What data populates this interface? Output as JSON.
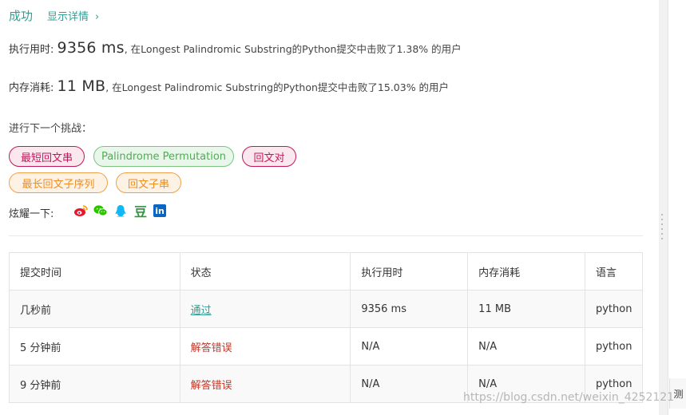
{
  "status": {
    "result": "成功",
    "details_link": "显示详情",
    "chevron": "›"
  },
  "runtime": {
    "label": "执行用时:",
    "value": "9356 ms",
    "desc": ", 在Longest Palindromic Substring的Python提交中击败了1.38% 的用户"
  },
  "memory": {
    "label": "内存消耗:",
    "value": "11 MB",
    "desc": ", 在Longest Palindromic Substring的Python提交中击败了15.03% 的用户"
  },
  "next_challenge": {
    "label": "进行下一个挑战：",
    "tags": [
      {
        "label": "最短回文串",
        "difficulty": "hard"
      },
      {
        "label": "Palindrome Permutation",
        "difficulty": "easy"
      },
      {
        "label": "回文对",
        "difficulty": "hard"
      },
      {
        "label": "最长回文子序列",
        "difficulty": "medium"
      },
      {
        "label": "回文子串",
        "difficulty": "medium"
      }
    ]
  },
  "share": {
    "label": "炫耀一下:",
    "icons": [
      "weibo-icon",
      "wechat-icon",
      "qq-icon",
      "douban-icon",
      "linkedin-icon"
    ],
    "douban_glyph": "豆",
    "linkedin_glyph": "in"
  },
  "table": {
    "headers": [
      "提交时间",
      "状态",
      "执行用时",
      "内存消耗",
      "语言"
    ],
    "rows": [
      [
        "几秒前",
        "通过",
        "9356 ms",
        "11 MB",
        "python"
      ],
      [
        "5 分钟前",
        "解答错误",
        "N/A",
        "N/A",
        "python"
      ],
      [
        "9 分钟前",
        "解答错误",
        "N/A",
        "N/A",
        "python"
      ]
    ]
  },
  "side_tab": "测",
  "watermark": "https://blog.csdn.net/weixin_4252121",
  "colors": {
    "accent": "#2f9f94",
    "hard": "#c2185b",
    "easy": "#4caf50",
    "medium": "#ef8c1f",
    "error": "#c0392b"
  }
}
